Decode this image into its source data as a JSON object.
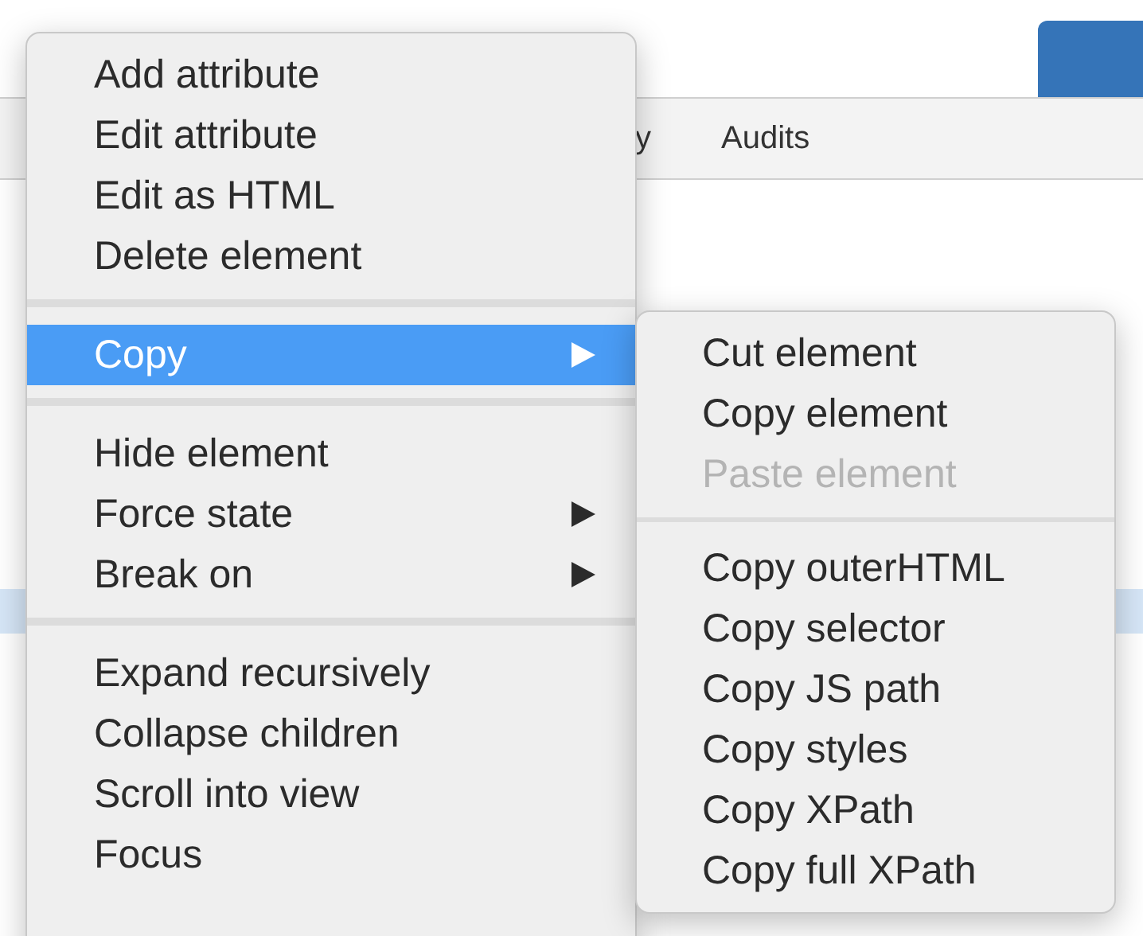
{
  "tabs": [
    {
      "label": "y"
    },
    {
      "label": "Audits"
    }
  ],
  "context_menu": {
    "groups": [
      [
        {
          "label": "Add attribute",
          "selected": false,
          "has_submenu": false
        },
        {
          "label": "Edit attribute",
          "selected": false,
          "has_submenu": false
        },
        {
          "label": "Edit as HTML",
          "selected": false,
          "has_submenu": false
        },
        {
          "label": "Delete element",
          "selected": false,
          "has_submenu": false
        }
      ],
      [
        {
          "label": "Copy",
          "selected": true,
          "has_submenu": true,
          "submenu": {
            "groups": [
              [
                {
                  "label": "Cut element",
                  "disabled": false
                },
                {
                  "label": "Copy element",
                  "disabled": false
                },
                {
                  "label": "Paste element",
                  "disabled": true
                }
              ],
              [
                {
                  "label": "Copy outerHTML",
                  "disabled": false
                },
                {
                  "label": "Copy selector",
                  "disabled": false
                },
                {
                  "label": "Copy JS path",
                  "disabled": false
                },
                {
                  "label": "Copy styles",
                  "disabled": false
                },
                {
                  "label": "Copy XPath",
                  "disabled": false
                },
                {
                  "label": "Copy full XPath",
                  "disabled": false
                }
              ]
            ]
          }
        }
      ],
      [
        {
          "label": "Hide element",
          "selected": false,
          "has_submenu": false
        },
        {
          "label": "Force state",
          "selected": false,
          "has_submenu": true
        },
        {
          "label": "Break on",
          "selected": false,
          "has_submenu": true
        }
      ],
      [
        {
          "label": "Expand recursively",
          "selected": false,
          "has_submenu": false
        },
        {
          "label": "Collapse children",
          "selected": false,
          "has_submenu": false
        },
        {
          "label": "Scroll into view",
          "selected": false,
          "has_submenu": false
        },
        {
          "label": "Focus",
          "selected": false,
          "has_submenu": false
        }
      ]
    ]
  }
}
